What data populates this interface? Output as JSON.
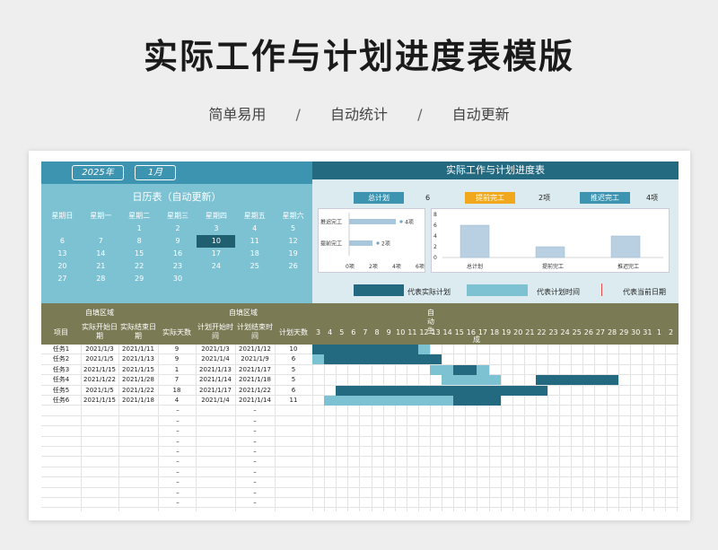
{
  "page": {
    "title": "实际工作与计划进度表模版",
    "subtitle_items": [
      "简单易用",
      "自动统计",
      "自动更新"
    ],
    "subtitle_sep": "/"
  },
  "calendar": {
    "year": "2025年",
    "month": "1月",
    "title": "日历表（自动更新）",
    "weekdays": [
      "星期日",
      "星期一",
      "星期二",
      "星期三",
      "星期四",
      "星期五",
      "星期六"
    ],
    "weeks": [
      [
        "",
        "",
        "1",
        "2",
        "3",
        "4",
        "5"
      ],
      [
        "6",
        "7",
        "8",
        "9",
        "10",
        "11",
        "12"
      ],
      [
        "13",
        "14",
        "15",
        "16",
        "17",
        "18",
        "19"
      ],
      [
        "20",
        "21",
        "22",
        "23",
        "24",
        "25",
        "26"
      ],
      [
        "27",
        "28",
        "29",
        "30",
        "",
        "",
        ""
      ]
    ],
    "today": "10"
  },
  "summary": {
    "header": "实际工作与计划进度表",
    "total_label": "总计划",
    "total_value": "6",
    "early_label": "提前完工",
    "early_value": "2项",
    "late_label": "推迟完工",
    "late_value": "4项",
    "hbar": {
      "categories": [
        "推迟完工",
        "提前完工"
      ],
      "values": [
        4,
        2
      ],
      "value_labels": [
        "4项",
        "2项"
      ],
      "ticks": [
        "0项",
        "2项",
        "4项",
        "6项"
      ]
    },
    "vbar": {
      "categories": [
        "总计划",
        "提前完工",
        "推迟完工"
      ],
      "values": [
        6,
        2,
        4
      ],
      "ticks": [
        "0",
        "2",
        "4",
        "6",
        "8"
      ]
    },
    "legend": {
      "actual": "代表实际计划",
      "plan": "代表计划时间",
      "today": "代表当前日期"
    },
    "colors": {
      "actual": "#236a80",
      "plan": "#7cc2d3",
      "today": "#e05050"
    }
  },
  "table": {
    "fill_area_1": "自填区域",
    "fill_area_2": "自填区域",
    "auto_gen": [
      "自",
      "动",
      "生",
      "成"
    ],
    "headers": [
      "项目",
      "实际开始日期",
      "实际结束日期",
      "实际天数",
      "计划开始时间",
      "计划结束时间",
      "计划天数"
    ],
    "day_labels": [
      "3",
      "4",
      "5",
      "6",
      "7",
      "8",
      "9",
      "10",
      "11",
      "12",
      "13",
      "14",
      "15",
      "16",
      "17",
      "18",
      "19",
      "20",
      "21",
      "22",
      "23",
      "24",
      "25",
      "26",
      "27",
      "28",
      "29",
      "30",
      "31",
      "1",
      "2"
    ],
    "rows": [
      {
        "name": "任务1",
        "act_start": "2021/1/3",
        "act_end": "2021/1/11",
        "act_days": "9",
        "plan_start": "2021/1/3",
        "plan_end": "2021/1/12",
        "plan_days": "10"
      },
      {
        "name": "任务2",
        "act_start": "2021/1/5",
        "act_end": "2021/1/13",
        "act_days": "9",
        "plan_start": "2021/1/4",
        "plan_end": "2021/1/9",
        "plan_days": "6"
      },
      {
        "name": "任务3",
        "act_start": "2021/1/15",
        "act_end": "2021/1/15",
        "act_days": "1",
        "plan_start": "2021/1/13",
        "plan_end": "2021/1/17",
        "plan_days": "5"
      },
      {
        "name": "任务4",
        "act_start": "2021/1/22",
        "act_end": "2021/1/28",
        "act_days": "7",
        "plan_start": "2021/1/14",
        "plan_end": "2021/1/18",
        "plan_days": "5"
      },
      {
        "name": "任务5",
        "act_start": "2021/1/5",
        "act_end": "2021/1/22",
        "act_days": "18",
        "plan_start": "2021/1/17",
        "plan_end": "2021/1/22",
        "plan_days": "6"
      },
      {
        "name": "任务6",
        "act_start": "2021/1/15",
        "act_end": "2021/1/18",
        "act_days": "4",
        "plan_start": "2021/1/4",
        "plan_end": "2021/1/14",
        "plan_days": "11"
      }
    ],
    "gantt": [
      {
        "actual": [
          1,
          9
        ],
        "plan": [
          9,
          10
        ]
      },
      {
        "actual": [
          2,
          11
        ],
        "plan": [
          1,
          2
        ]
      },
      {
        "actual": [
          13,
          14
        ],
        "plan": [
          11,
          15
        ]
      },
      {
        "actual": [
          20,
          26
        ],
        "plan": [
          12,
          16
        ]
      },
      {
        "actual": [
          3,
          20
        ],
        "plan": [
          15,
          20
        ]
      },
      {
        "actual": [
          13,
          16
        ],
        "plan": [
          2,
          12
        ]
      }
    ],
    "empty_dash": "–",
    "empty_rows": 15
  }
}
